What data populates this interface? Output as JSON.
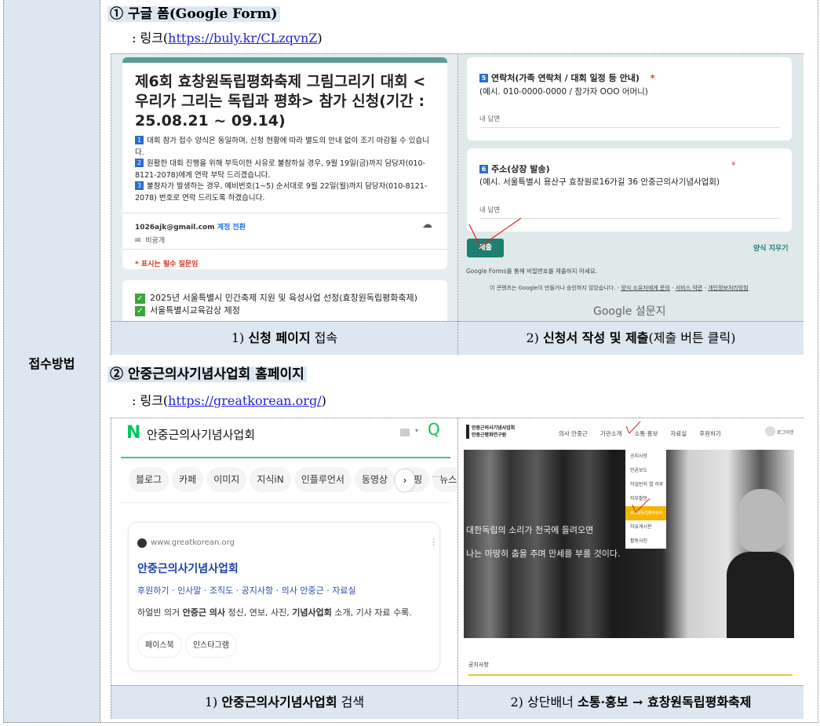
{
  "row_label": "접수방법",
  "section1": {
    "heading": "① 구글 폼(Google Form)",
    "link_prefix": ": 링크(",
    "link": "https://buly.kr/CLzqvnZ",
    "link_suffix": ")",
    "form_left": {
      "title": "제6회 효창원독립평화축제 그림그리기 대회 < 우리가 그리는 독립과 평화> 참가 신청(기간 : 25.08.21 ~ 09.14)",
      "notes": [
        {
          "num": "1",
          "text": "대회 참가 접수 양식은 동일하며, 신청 현황에 따라 별도의 안내 없이 조기 마감될 수 있습니다."
        },
        {
          "num": "2",
          "text": "원활한 대회 진행을 위해 부득이한 사유로 불참하실 경우, 9월 19일(금)까지 담당자(010-8121-2078)에게 연락 부탁 드리겠습니다."
        },
        {
          "num": "3",
          "text": "불참자가 발생하는 경우, 예비번호(1~5) 순서대로  9월 22일(월)까지 담당자(010-8121-2078) 번호로 연락 드리도록 하겠습니다."
        }
      ],
      "email": "1026ajk@gmail.com",
      "switch_account": "계정 전환",
      "private": "비공개",
      "required_note": "* 표시는 필수 질문임",
      "checks": [
        "2025년 서울특별시 민간축제 지원 및 육성사업 선정(효창원독립평화축제)",
        "서울특별시교육감상 제정"
      ]
    },
    "form_right": {
      "q5_num": "5",
      "q5_title": "연락처(가족 연락처 / 대회 일정 등 안내)",
      "q5_example": "(예시. 010-0000-0000 / 참가자 OOO 어머니)",
      "q6_num": "6",
      "q6_title": "주소(상장 발송)",
      "q6_example": "(예시. 서울특별시 용산구 효창원로16가길 36 안중근의사기념사업회)",
      "required_star": "*",
      "answer_placeholder": "내 답변",
      "submit": "제출",
      "clear": "양식 지우기",
      "password_warning": "Google Forms를 통해 비밀번호를 제출하지 마세요.",
      "disclaimer": "이 콘텐츠는 Google이 만들거나 승인하지 않았습니다. -",
      "contact_owner": "양식 소유자에게 문의",
      "terms": "서비스 약관",
      "privacy": "개인정보처리방침",
      "sep": " - ",
      "brand": "Google 설문지"
    },
    "caption1_num": "1)",
    "caption1_bold": "신청 페이지",
    "caption1_rest": "접속",
    "caption2_num": "2)",
    "caption2_bold": "신청서 작성 및 제출",
    "caption2_rest": "(제출 버튼 클릭)"
  },
  "section2": {
    "heading": "② 안중근의사기념사업회 홈페이지",
    "link_prefix": ": 링크(",
    "link": "https://greatkorean.org/",
    "link_suffix": ")",
    "naver": {
      "logo": "N",
      "query": "안중근의사기념사업회",
      "tabs": [
        "블로그",
        "카페",
        "이미지",
        "지식iN",
        "인플루언서",
        "동영상",
        "쇼핑",
        "뉴스"
      ],
      "more": "···",
      "site_url": "www.greatkorean.org",
      "result_title": "안중근의사기념사업회",
      "sitelinks": "후원하기 · 인사말 · 조직도 · 공지사항 · 의사 안중근 · 자료실",
      "desc_1": "하얼빈 의거 ",
      "desc_b1": "안중근 의사",
      "desc_2": " 정신, 연보, 사진, ",
      "desc_b2": "기념사업회",
      "desc_3": " 소개, 기사 자료 수록.",
      "chips": [
        "페이스북",
        "인스타그램"
      ]
    },
    "site": {
      "logo_line1": "안중근의사기념사업회",
      "logo_line2": "안중근평화연구원",
      "nav": [
        "의사 안중근",
        "기관소개",
        "소통·홍보",
        "자료실",
        "후원하기"
      ],
      "login": "로그아웃",
      "dropdown": [
        "공지사항",
        "언론보도",
        "하얼빈의 열 하루",
        "지부활동",
        "효창원독립평화축제",
        "자유게시판",
        "활동사진"
      ],
      "banner_line1": "대한독립의 소리가 천국에 들려오면",
      "banner_line2": "나는 마땅히 춤을 추며 만세를 부를 것이다.",
      "notice": "공지사항"
    },
    "caption1_num": "1)",
    "caption1_bold": "안중근의사기념사업회",
    "caption1_rest": "검색",
    "caption2_num": "2)",
    "caption2_rest": "상단배너",
    "caption2_bold": "소통·홍보 → 효창원독립평화축제"
  },
  "colors": {
    "accent_teal": "#1d7f72",
    "highlight": "#f5b400",
    "naver_green": "#03c75a",
    "link_blue": "#2323d8"
  }
}
